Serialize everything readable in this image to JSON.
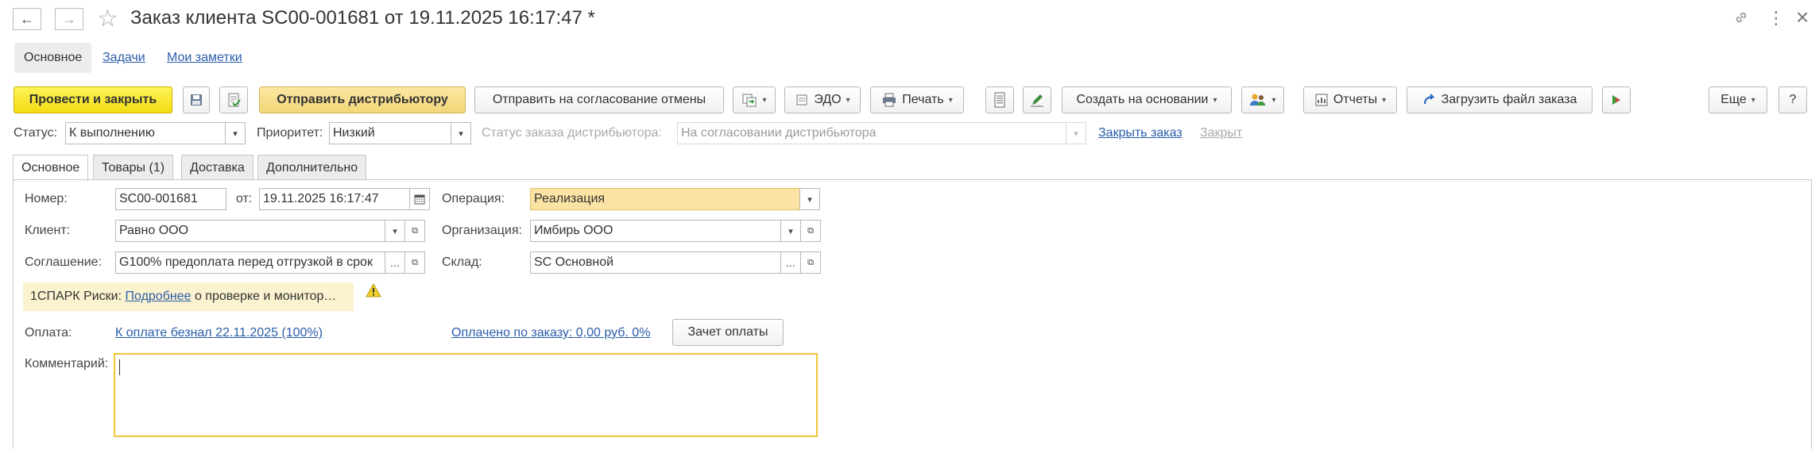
{
  "window": {
    "title": "Заказ клиента SC00-001681 от 19.11.2025 16:17:47 *"
  },
  "icons": {
    "back": "←",
    "forward": "→",
    "star": "☆",
    "link": "🔗",
    "more": "⋮",
    "close": "×",
    "save": "🖫",
    "post": "▦",
    "print": "🖶",
    "warning": "⚠",
    "calendar": "▦",
    "ellipsis": "...",
    "open": "⧉",
    "caret": "▾"
  },
  "top_tabs": [
    "Основное",
    "Задачи",
    "Мои заметки"
  ],
  "toolbar": {
    "post_close": "Провести и закрыть",
    "send_distributor": "Отправить дистрибьютору",
    "send_cancel": "Отправить на согласование отмены",
    "edo": "ЭДО",
    "print": "Печать",
    "create_based": "Создать на основании",
    "reports": "Отчеты",
    "load_file": "Загрузить файл заказа",
    "more": "Еще",
    "help": "?"
  },
  "status_row": {
    "status_label": "Статус:",
    "status_value": "К выполнению",
    "priority_label": "Приоритет:",
    "priority_value": "Низкий",
    "dist_status_label": "Статус заказа дистрибьютора:",
    "dist_status_value": "На согласовании дистрибьютора",
    "close_order": "Закрыть заказ",
    "closed": "Закрыт"
  },
  "page_tabs": [
    "Основное",
    "Товары (1)",
    "Доставка",
    "Дополнительно"
  ],
  "form": {
    "number_label": "Номер:",
    "number_value": "SC00-001681",
    "from_label": "от:",
    "date_value": "19.11.2025 16:17:47",
    "operation_label": "Операция:",
    "operation_value": "Реализация",
    "client_label": "Клиент:",
    "client_value": "Равно ООО",
    "org_label": "Организация:",
    "org_value": "Имбирь ООО",
    "agreement_label": "Соглашение:",
    "agreement_value": "G100% предоплата перед отгрузкой в срок",
    "warehouse_label": "Склад:",
    "warehouse_value": "SC Основной",
    "spark_prefix": "1СПАРК Риски:",
    "spark_link": "Подробнее",
    "spark_suffix": "о проверке и монитор…",
    "payment_label": "Оплата:",
    "payment_link": "К оплате безнал 22.11.2025 (100%)",
    "paid_link": "Оплачено по заказу: 0,00 руб. 0%",
    "offset_button": "Зачет оплаты",
    "comment_label": "Комментарий:",
    "comment_value": ""
  },
  "colors": {
    "accent_yellow": "#f5e11a",
    "link": "#2a5caa",
    "highlight": "#fbe3a3"
  }
}
